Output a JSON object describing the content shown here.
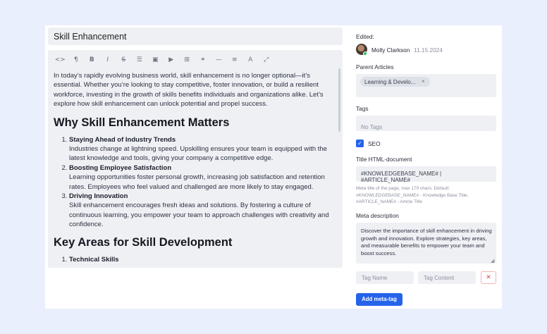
{
  "editor": {
    "title": "Skill Enhancement",
    "toolbar": [
      {
        "icon": "code-icon",
        "glyph": "<>"
      },
      {
        "icon": "paragraph-icon",
        "glyph": "¶"
      },
      {
        "icon": "bold-icon",
        "glyph": "B"
      },
      {
        "icon": "italic-icon",
        "glyph": "I"
      },
      {
        "icon": "strikethrough-icon",
        "glyph": "S"
      },
      {
        "icon": "bullet-list-icon",
        "glyph": "☰"
      },
      {
        "icon": "image-icon",
        "glyph": "▣"
      },
      {
        "icon": "video-icon",
        "glyph": "▶"
      },
      {
        "icon": "table-icon",
        "glyph": "⊞"
      },
      {
        "icon": "link-icon",
        "glyph": "⚭"
      },
      {
        "icon": "horizontal-rule-icon",
        "glyph": "—"
      },
      {
        "icon": "align-icon",
        "glyph": "≡"
      },
      {
        "icon": "text-color-icon",
        "glyph": "A"
      },
      {
        "icon": "fullscreen-icon",
        "glyph": "⤢"
      }
    ],
    "intro": "In today’s rapidly evolving business world, skill enhancement is no longer optional—it’s essential. Whether you’re looking to stay competitive, foster innovation, or build a resilient workforce, investing in the growth of skills benefits individuals and organizations alike. Let’s explore how skill enhancement can unlock potential and propel success.",
    "heading1": "Why Skill Enhancement Matters",
    "items": [
      {
        "title": "Staying Ahead of Industry Trends",
        "desc": "Industries change at lightning speed. Upskilling ensures your team is equipped with the latest knowledge and tools, giving your company a competitive edge."
      },
      {
        "title": "Boosting Employee Satisfaction",
        "desc": "Learning opportunities foster personal growth, increasing job satisfaction and retention rates. Employees who feel valued and challenged are more likely to stay engaged."
      },
      {
        "title": "Driving Innovation",
        "desc": "Skill enhancement encourages fresh ideas and solutions. By fostering a culture of continuous learning, you empower your team to approach challenges with creativity and confidence."
      }
    ],
    "heading2": "Key Areas for Skill Development",
    "items2": [
      {
        "title": "Technical Skills"
      }
    ]
  },
  "sidebar": {
    "edited_label": "Edited:",
    "author": "Molly Clarkson",
    "date": "11.15.2024",
    "parent_label": "Parent Articles",
    "parent_chip": "Learning & Develo...",
    "parent_chip_remove": "×",
    "tags_label": "Tags",
    "tags_placeholder": "No Tags",
    "seo_checked": true,
    "seo_check_glyph": "✓",
    "seo_label": "SEO",
    "title_doc_label": "Title HTML-document",
    "title_doc_value": "#KNOWLEDGEBASE_NAME# | #ARTICLE_NAME#",
    "title_help": "Meta title of the page, max 170 chars. Default: #KNOWLEDGEBASE_NAME# - Knowledge Base Title, #ARTICLE_NAME# - Article Title",
    "meta_label": "Meta description",
    "meta_value": "Discover the importance of skill enhancement in driving growth and innovation. Explore strategies, key areas, and measurable benefits to empower your team and boost success.",
    "tag_name_placeholder": "Tag Name",
    "tag_content_placeholder": "Tag Content",
    "delete_glyph": "✕",
    "add_meta_label": "Add meta-tag"
  },
  "colors": {
    "accent": "#2563eb",
    "page_bg": "#e9effc",
    "field_bg": "#eef0f4",
    "danger": "#ef4444"
  }
}
